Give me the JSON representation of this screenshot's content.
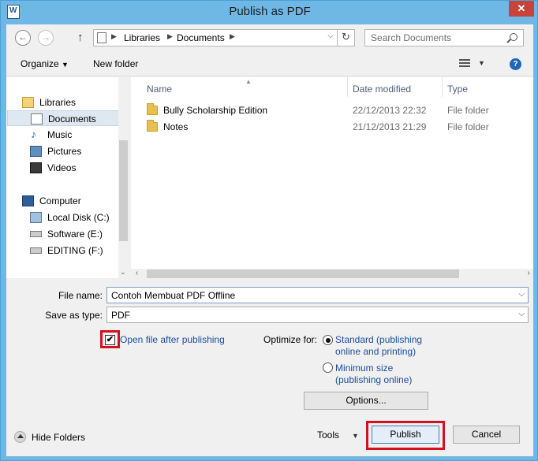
{
  "window": {
    "title": "Publish as PDF",
    "close_label": "✕"
  },
  "address_bar": {
    "crumbs": [
      "Libraries",
      "Documents"
    ]
  },
  "search": {
    "placeholder": "Search Documents"
  },
  "toolbar": {
    "organize_label": "Organize",
    "new_folder_label": "New folder",
    "help_label": "?"
  },
  "nav": {
    "items": [
      {
        "label": "Libraries",
        "icon": "libraries-icon"
      },
      {
        "label": "Documents",
        "icon": "documents-icon",
        "selected": true
      },
      {
        "label": "Music",
        "icon": "music-icon"
      },
      {
        "label": "Pictures",
        "icon": "pictures-icon"
      },
      {
        "label": "Videos",
        "icon": "videos-icon"
      },
      {
        "label": "Computer",
        "icon": "computer-icon"
      },
      {
        "label": "Local Disk (C:)",
        "icon": "drive-icon"
      },
      {
        "label": "Software (E:)",
        "icon": "drive-icon"
      },
      {
        "label": "EDITING (F:)",
        "icon": "drive-icon"
      }
    ]
  },
  "files": {
    "columns": [
      "Name",
      "Date modified",
      "Type"
    ],
    "rows": [
      {
        "name": "Bully Scholarship Edition",
        "date": "22/12/2013 22:32",
        "type": "File folder"
      },
      {
        "name": "Notes",
        "date": "21/12/2013 21:29",
        "type": "File folder"
      }
    ]
  },
  "form": {
    "file_name_label": "File name:",
    "file_name_value": "Contoh Membuat PDF Offline",
    "save_type_label": "Save as type:",
    "save_type_value": "PDF",
    "open_after_label": "Open file after publishing",
    "open_after_checked": true,
    "optimize_label": "Optimize for:",
    "standard_label_1": "Standard (publishing",
    "standard_label_2": "online and printing)",
    "minimum_label_1": "Minimum size",
    "minimum_label_2": "(publishing online)",
    "selected_optimize": "Standard",
    "options_label": "Options..."
  },
  "footer": {
    "hide_folders_label": "Hide Folders",
    "tools_label": "Tools",
    "publish_label": "Publish",
    "cancel_label": "Cancel"
  },
  "colors": {
    "titlebar": "#6fb8e6",
    "close": "#c7443a",
    "highlight": "#d4121e",
    "link": "#1a4e9c"
  }
}
